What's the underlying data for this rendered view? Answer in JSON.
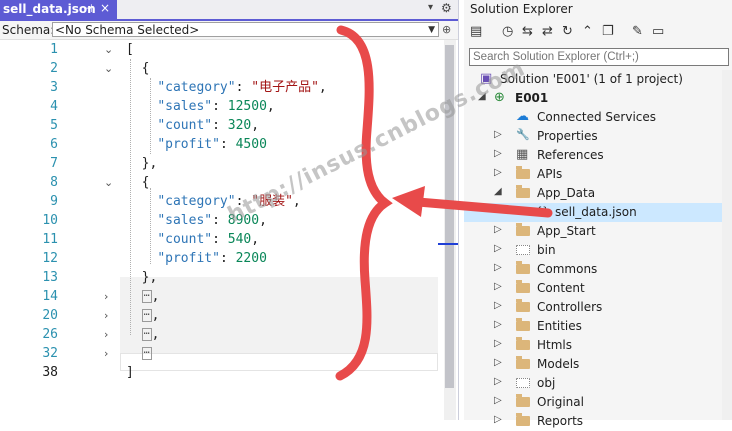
{
  "tab": {
    "filename": "sell_data.json",
    "pin": "⊣",
    "close": "×"
  },
  "schema": {
    "label": "Schema:",
    "value": "<No Schema Selected>"
  },
  "code": {
    "lines": [
      {
        "no": "1",
        "text": "["
      },
      {
        "no": "2",
        "text": "{"
      },
      {
        "no": "3",
        "key": "\"category\"",
        "value": "\"电子产品\"",
        "vtype": "str"
      },
      {
        "no": "4",
        "key": "\"sales\"",
        "value": "12500",
        "vtype": "num"
      },
      {
        "no": "5",
        "key": "\"count\"",
        "value": "320",
        "vtype": "num"
      },
      {
        "no": "6",
        "key": "\"profit\"",
        "value": "4500",
        "vtype": "num",
        "last": true
      },
      {
        "no": "7",
        "text": "},"
      },
      {
        "no": "8",
        "text": "{"
      },
      {
        "no": "9",
        "key": "\"category\"",
        "value": "\"服装\"",
        "vtype": "str"
      },
      {
        "no": "10",
        "key": "\"sales\"",
        "value": "8900",
        "vtype": "num"
      },
      {
        "no": "11",
        "key": "\"count\"",
        "value": "540",
        "vtype": "num"
      },
      {
        "no": "12",
        "key": "\"profit\"",
        "value": "2200",
        "vtype": "num",
        "last": true
      },
      {
        "no": "13",
        "text": "},"
      },
      {
        "no": "14",
        "collapsed": true,
        "suffix": ","
      },
      {
        "no": "20",
        "collapsed": true,
        "suffix": ","
      },
      {
        "no": "26",
        "collapsed": true,
        "suffix": ","
      },
      {
        "no": "32",
        "collapsed": true,
        "suffix": ""
      },
      {
        "no": "38",
        "text": "]"
      }
    ]
  },
  "watermark": "http://insus.cnblogs.com",
  "solution_explorer": {
    "title": "Solution Explorer",
    "search_placeholder": "Search Solution Explorer (Ctrl+;)",
    "solution_label": "Solution 'E001' (1 of 1 project)",
    "project": "E001",
    "items": [
      {
        "label": "Connected Services",
        "icon": "cloud-icon"
      },
      {
        "label": "Properties",
        "icon": "wrench-icon"
      },
      {
        "label": "References",
        "icon": "references-icon"
      },
      {
        "label": "APIs",
        "icon": "folder-icon"
      },
      {
        "label": "App_Data",
        "icon": "folder-icon"
      },
      {
        "label": "sell_data.json",
        "icon": "json-file-icon"
      },
      {
        "label": "App_Start",
        "icon": "folder-icon"
      },
      {
        "label": "bin",
        "icon": "folder-dashed-icon"
      },
      {
        "label": "Commons",
        "icon": "folder-icon"
      },
      {
        "label": "Content",
        "icon": "folder-icon"
      },
      {
        "label": "Controllers",
        "icon": "folder-icon"
      },
      {
        "label": "Entities",
        "icon": "folder-icon"
      },
      {
        "label": "Htmls",
        "icon": "folder-icon"
      },
      {
        "label": "Models",
        "icon": "folder-icon"
      },
      {
        "label": "obj",
        "icon": "folder-dashed-icon"
      },
      {
        "label": "Original",
        "icon": "folder-icon"
      },
      {
        "label": "Reports",
        "icon": "folder-icon"
      }
    ]
  },
  "colors": {
    "tab_active": "#5d5bd4",
    "annotation": "#e84a4a",
    "selection": "#cce8ff"
  }
}
